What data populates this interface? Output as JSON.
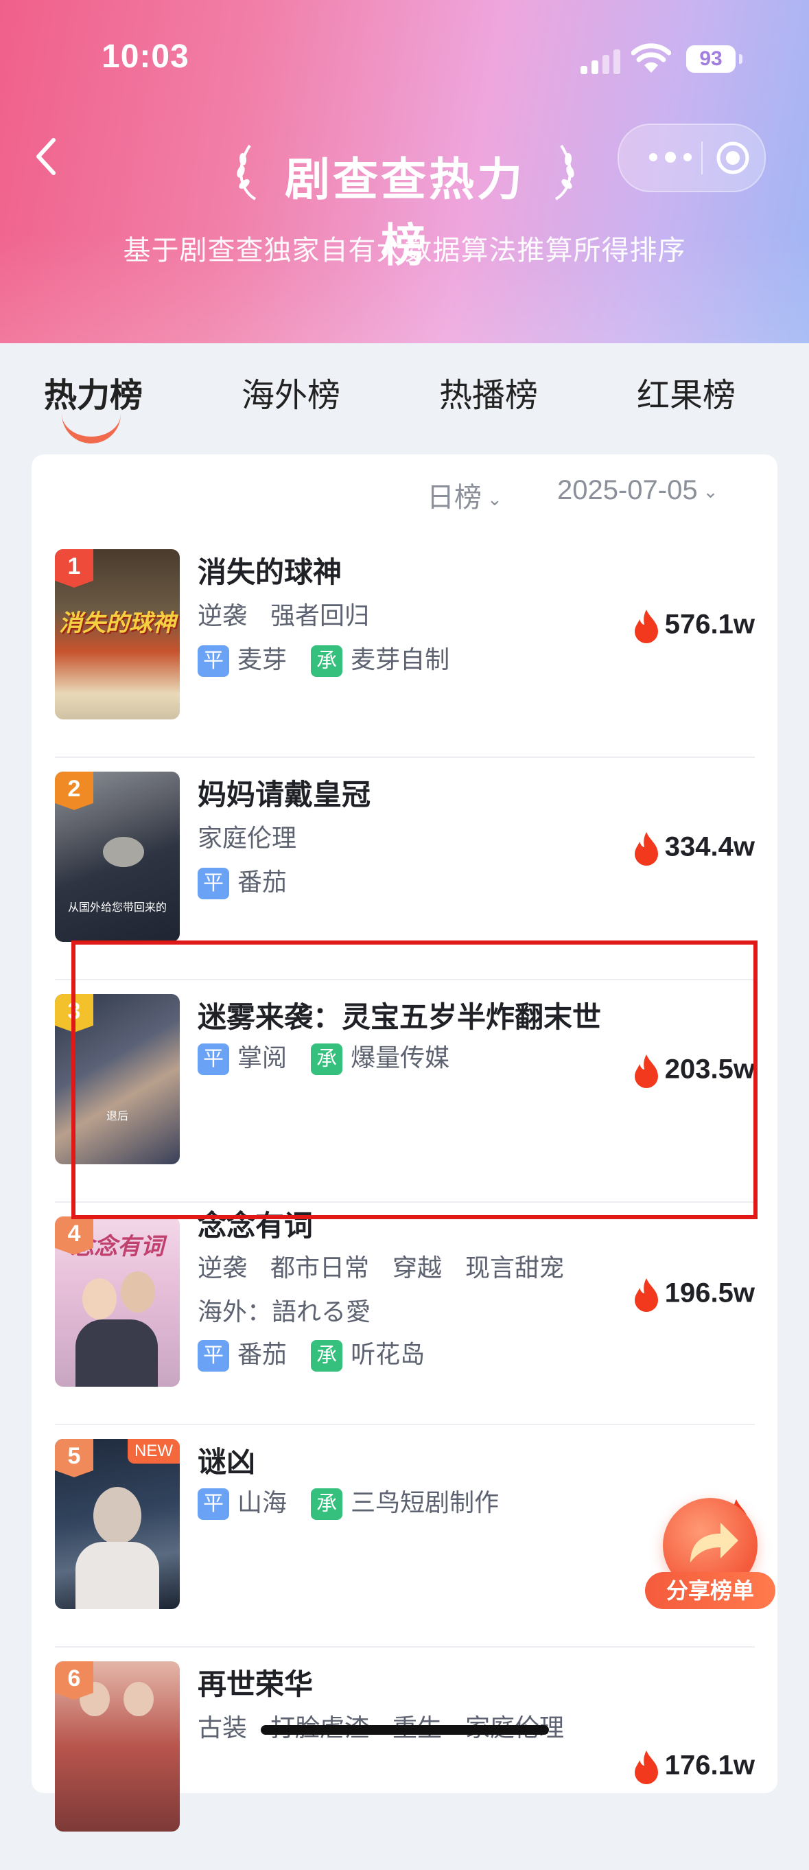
{
  "status_bar": {
    "time": "10:03",
    "battery": "93"
  },
  "header": {
    "title": "剧查查热力榜",
    "subtitle": "基于剧查查独家自有大数据算法推算所得排序"
  },
  "tabs": [
    "热力榜",
    "海外榜",
    "热播榜",
    "红果榜"
  ],
  "active_tab": "热力榜",
  "filters": {
    "period": "日榜",
    "date": "2025-07-05"
  },
  "items": [
    {
      "rank": "1",
      "title": "消失的球神",
      "tags": [
        "逆袭",
        "强者回归"
      ],
      "platform_label": "平",
      "platform": "麦芽",
      "producer_label": "承",
      "producer": "麦芽自制",
      "heat": "576.1w",
      "poster_text": "消失的球神"
    },
    {
      "rank": "2",
      "title": "妈妈请戴皇冠",
      "tags": [
        "家庭伦理"
      ],
      "platform_label": "平",
      "platform": "番茄",
      "heat": "334.4w",
      "poster_text": "从国外给您带回来的"
    },
    {
      "rank": "3",
      "title": "迷雾来袭：灵宝五岁半炸翻末世",
      "tags": [],
      "platform_label": "平",
      "platform": "掌阅",
      "producer_label": "承",
      "producer": "爆量传媒",
      "heat": "203.5w",
      "poster_text": "退后"
    },
    {
      "rank": "4",
      "title": "念念有词",
      "tags": [
        "逆袭",
        "都市日常",
        "穿越",
        "现言甜宠"
      ],
      "overseas": "海外：語れる愛",
      "platform_label": "平",
      "platform": "番茄",
      "producer_label": "承",
      "producer": "听花岛",
      "heat": "196.5w",
      "poster_text": "念念有词"
    },
    {
      "rank": "5",
      "title": "谜凶",
      "badge": "NEW",
      "tags": [],
      "platform_label": "平",
      "platform": "山海",
      "producer_label": "承",
      "producer": "三鸟短剧制作",
      "heat": ""
    },
    {
      "rank": "6",
      "title": "再世荣华",
      "tags": [
        "古装",
        "打脸虐渣",
        "重生",
        "家庭伦理"
      ],
      "heat": "176.1w"
    }
  ],
  "share_button": {
    "label": "分享榜单"
  },
  "colors": {
    "accent": "#f26a4d",
    "highlight": "#e01818",
    "platform_tag": "#6aa2f5",
    "producer_tag": "#35c07e"
  },
  "icons": [
    "back-arrow-icon",
    "laurel-left-icon",
    "laurel-right-icon",
    "more-dots-icon",
    "close-target-icon",
    "chevron-down-icon",
    "flame-icon",
    "share-arrow-icon"
  ]
}
